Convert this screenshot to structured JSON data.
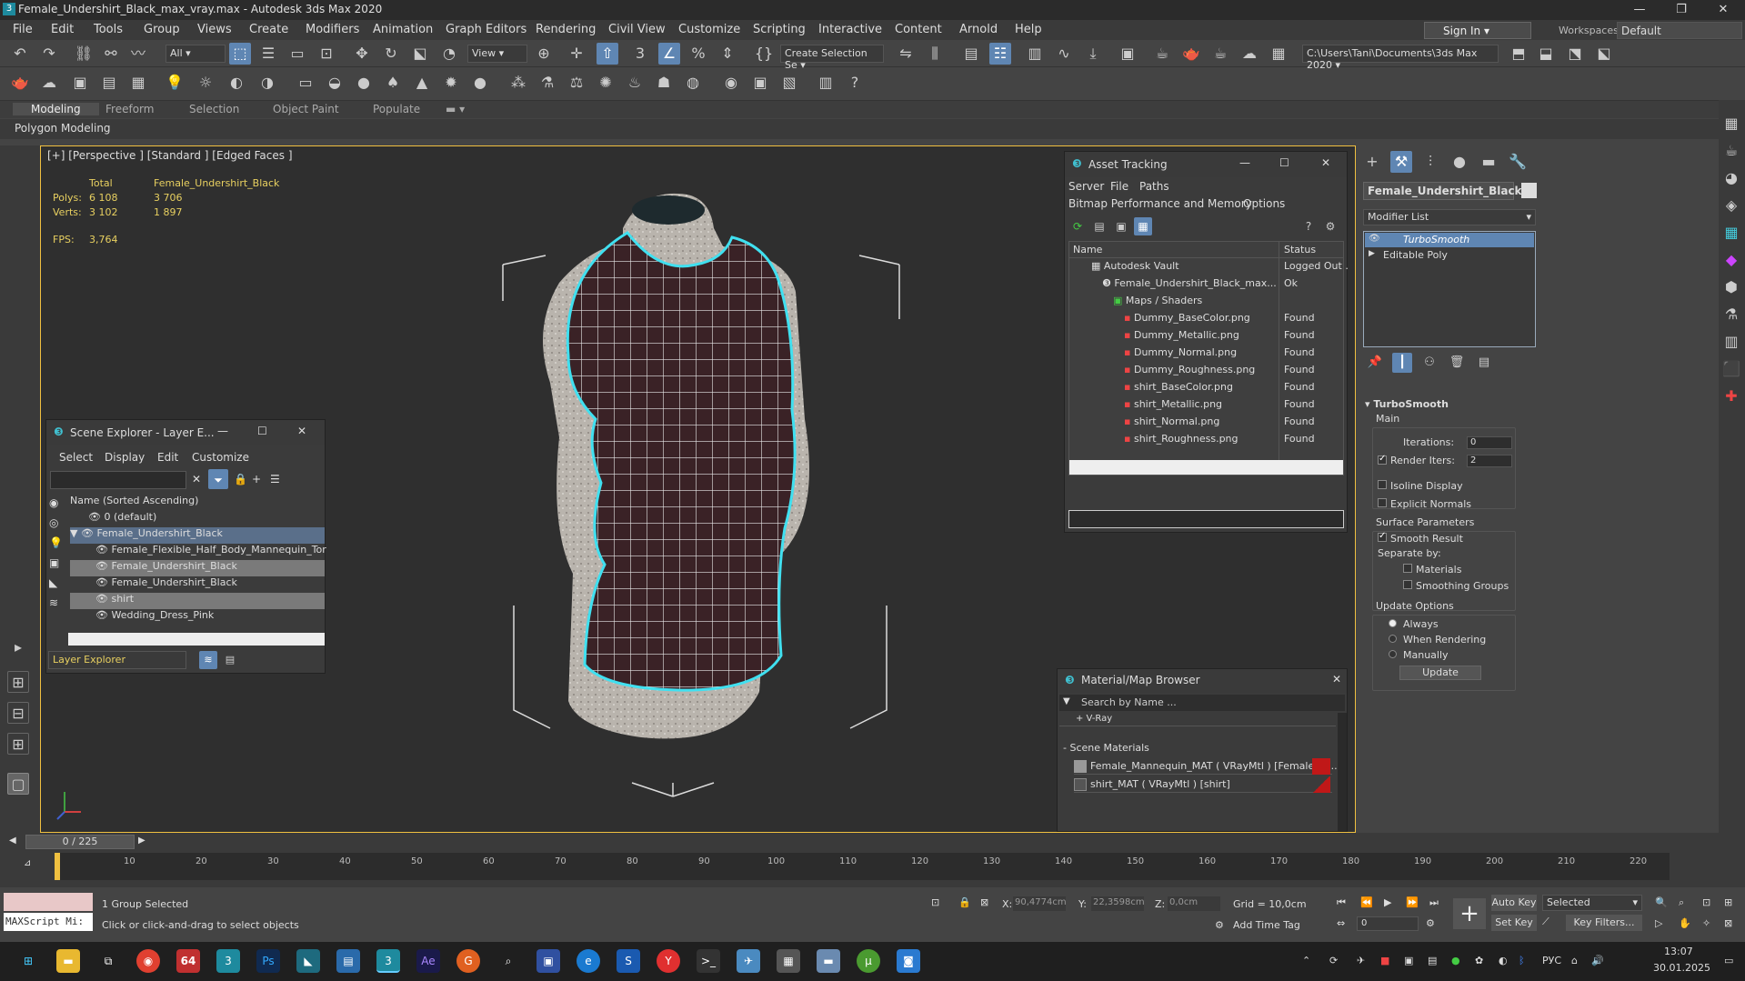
{
  "app": {
    "title": "Female_Undershirt_Black_max_vray.max - Autodesk 3ds Max 2020",
    "menu": [
      "File",
      "Edit",
      "Tools",
      "Group",
      "Views",
      "Create",
      "Modifiers",
      "Animation",
      "Graph Editors",
      "Rendering",
      "Civil View",
      "Customize",
      "Scripting",
      "Interactive",
      "Content",
      "Arnold",
      "Help"
    ],
    "sign_in": "Sign In",
    "workspaces_label": "Workspaces:",
    "workspace": "Default"
  },
  "toolbar": {
    "filter": "All",
    "view_dropdown": "View",
    "selection_set": "Create Selection Se",
    "project_path": "C:\\Users\\Tani\\Documents\\3ds Max 2020"
  },
  "ribbon": {
    "tabs": [
      "Modeling",
      "Freeform",
      "Selection",
      "Object Paint",
      "Populate"
    ],
    "sub": "Polygon Modeling"
  },
  "viewport": {
    "label": "[+] [Perspective ] [Standard ] [Edged Faces ]",
    "stats": {
      "total_label": "Total",
      "object_label": "Female_Undershirt_Black",
      "polys_label": "Polys:",
      "polys_total": "6 108",
      "polys_obj": "3 706",
      "verts_label": "Verts:",
      "verts_total": "3 102",
      "verts_obj": "1 897",
      "fps_label": "FPS:",
      "fps": "3,764"
    }
  },
  "scene_explorer": {
    "title": "Scene Explorer - Layer E...",
    "menu": [
      "Select",
      "Display",
      "Edit",
      "Customize"
    ],
    "column": "Name (Sorted Ascending)",
    "rows": [
      {
        "label": "0 (default)",
        "indent": 0
      },
      {
        "label": "Female_Undershirt_Black",
        "indent": 0
      },
      {
        "label": "Female_Flexible_Half_Body_Mannequin_Tor",
        "indent": 1
      },
      {
        "label": "Female_Undershirt_Black",
        "indent": 1
      },
      {
        "label": "Female_Undershirt_Black",
        "indent": 1
      },
      {
        "label": "shirt",
        "indent": 1
      },
      {
        "label": "Wedding_Dress_Pink",
        "indent": 1
      }
    ],
    "footer": "Layer Explorer"
  },
  "asset_tracking": {
    "title": "Asset Tracking",
    "menu1": [
      "Server",
      "File",
      "Paths"
    ],
    "menu2": [
      "Bitmap Performance and Memory",
      "Options"
    ],
    "col_name": "Name",
    "col_status": "Status",
    "rows": [
      {
        "name": "Autodesk Vault",
        "status": "Logged Out ."
      },
      {
        "name": "Female_Undershirt_Black_max...",
        "status": "Ok"
      },
      {
        "name": "Maps / Shaders",
        "status": ""
      },
      {
        "name": "Dummy_BaseColor.png",
        "status": "Found"
      },
      {
        "name": "Dummy_Metallic.png",
        "status": "Found"
      },
      {
        "name": "Dummy_Normal.png",
        "status": "Found"
      },
      {
        "name": "Dummy_Roughness.png",
        "status": "Found"
      },
      {
        "name": "shirt_BaseColor.png",
        "status": "Found"
      },
      {
        "name": "shirt_Metallic.png",
        "status": "Found"
      },
      {
        "name": "shirt_Normal.png",
        "status": "Found"
      },
      {
        "name": "shirt_Roughness.png",
        "status": "Found"
      }
    ]
  },
  "material_browser": {
    "title": "Material/Map Browser",
    "search_placeholder": "Search by Name ...",
    "vray": "+ V-Ray",
    "section": "- Scene Materials",
    "items": [
      "Female_Mannequin_MAT  ( VRayMtl )  [Female_Fl...",
      "shirt_MAT  ( VRayMtl )  [shirt]"
    ]
  },
  "command_panel": {
    "object_name": "Female_Undershirt_Black",
    "modifier_list": "Modifier List",
    "stack": [
      "TurboSmooth",
      "Editable Poly"
    ],
    "rollout": "TurboSmooth",
    "main": "Main",
    "iterations_label": "Iterations:",
    "iterations": "0",
    "render_iters_label": "Render Iters:",
    "render_iters": "2",
    "isoline": "Isoline Display",
    "explicit": "Explicit Normals",
    "surface": "Surface Parameters",
    "smooth_result": "Smooth Result",
    "separate_by": "Separate by:",
    "materials": "Materials",
    "smoothing_groups": "Smoothing Groups",
    "update_options": "Update Options",
    "always": "Always",
    "when_rendering": "When Rendering",
    "manually": "Manually",
    "update_btn": "Update"
  },
  "timeline": {
    "frame": "0 / 225",
    "ticks": [
      "10",
      "20",
      "30",
      "40",
      "50",
      "60",
      "70",
      "80",
      "90",
      "100",
      "110",
      "120",
      "130",
      "140",
      "150",
      "160",
      "170",
      "180",
      "190",
      "200",
      "210",
      "220"
    ]
  },
  "status": {
    "maxscript": "MAXScript Mi:",
    "selected": "1 Group Selected",
    "hint": "Click or click-and-drag to select objects",
    "x_label": "X:",
    "x": "90,4774cm",
    "y_label": "Y:",
    "y": "22,3598cm",
    "z_label": "Z:",
    "z": "0,0cm",
    "grid": "Grid = 10,0cm",
    "add_time_tag": "Add Time Tag",
    "auto_key": "Auto Key",
    "selected_dd": "Selected",
    "set_key": "Set Key",
    "key_filters": "Key Filters...",
    "frame_field": "0"
  },
  "taskbar": {
    "lang": "РУС",
    "time": "13:07",
    "date": "30.01.2025"
  },
  "colors": {
    "accent": "#5f86b3",
    "viewport_border": "#f0c040",
    "selection_cyan": "#40e0f0"
  }
}
